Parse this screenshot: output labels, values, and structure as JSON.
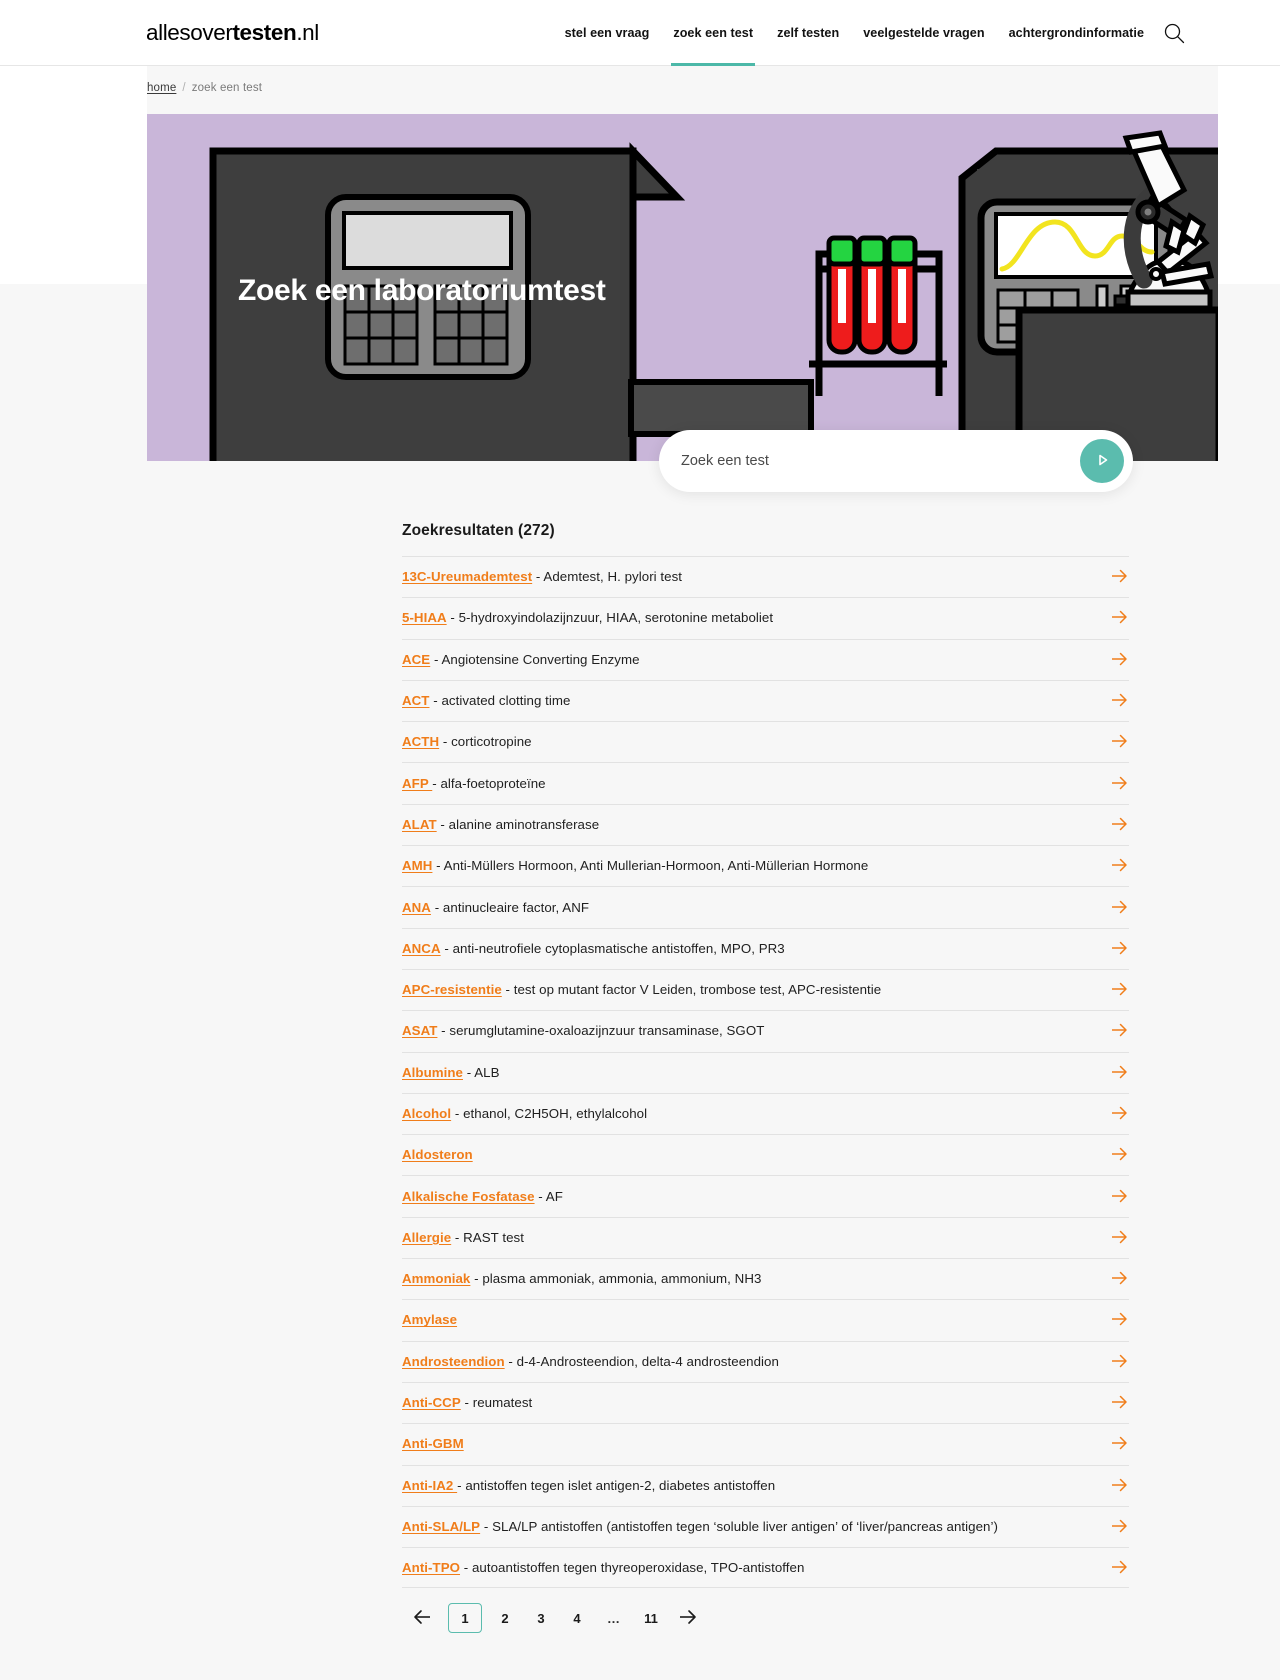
{
  "header": {
    "logo_light_1": "allesover",
    "logo_bold": "testen",
    "logo_light_2": ".nl",
    "nav": [
      {
        "label": "stel een vraag",
        "active": false
      },
      {
        "label": "zoek een test",
        "active": true
      },
      {
        "label": "zelf testen",
        "active": false
      },
      {
        "label": "veelgestelde vragen",
        "active": false
      },
      {
        "label": "achtergrondinformatie",
        "active": false
      }
    ],
    "search_icon": "search-icon"
  },
  "breadcrumb": {
    "home": "home",
    "separator": "/",
    "current": "zoek een test"
  },
  "hero": {
    "title": "Zoek een laboratoriumtest",
    "background_color": "#c9b6d9",
    "illustration": "laboratory-illustration"
  },
  "search": {
    "placeholder": "Zoek een test",
    "value": "",
    "button_icon": "play-arrow-icon",
    "button_color": "#5bbcae"
  },
  "results": {
    "heading": "Zoekresultaten (272)",
    "count": 272,
    "arrow_icon": "arrow-right-icon",
    "link_color": "#f07d1a",
    "items": [
      {
        "term": "13C-Ureumademtest",
        "desc": " - Ademtest, H. pylori test"
      },
      {
        "term": "5-HIAA",
        "desc": " - 5-hydroxyindolazijnzuur, HIAA, serotonine metaboliet"
      },
      {
        "term": "ACE",
        "desc": " - Angiotensine Converting Enzyme"
      },
      {
        "term": "ACT",
        "desc": " - activated clotting time"
      },
      {
        "term": "ACTH",
        "desc": " - corticotropine"
      },
      {
        "term": "AFP ",
        "desc": "- alfa-foetoproteïne"
      },
      {
        "term": "ALAT",
        "desc": " - alanine aminotransferase"
      },
      {
        "term": "AMH",
        "desc": " - Anti-Müllers Hormoon, Anti Mullerian-Hormoon, Anti-Müllerian Hormone"
      },
      {
        "term": "ANA",
        "desc": " - antinucleaire factor, ANF"
      },
      {
        "term": "ANCA",
        "desc": " - anti-neutrofiele cytoplasmatische antistoffen, MPO, PR3"
      },
      {
        "term": "APC-resistentie",
        "desc": " - test op mutant factor V Leiden, trombose test, APC-resistentie"
      },
      {
        "term": "ASAT",
        "desc": " - serumglutamine-oxaloazijnzuur transaminase, SGOT"
      },
      {
        "term": "Albumine",
        "desc": " - ALB"
      },
      {
        "term": "Alcohol",
        "desc": " - ethanol, C2H5OH, ethylalcohol"
      },
      {
        "term": "Aldosteron",
        "desc": ""
      },
      {
        "term": "Alkalische Fosfatase",
        "desc": " - AF"
      },
      {
        "term": "Allergie",
        "desc": " - RAST test"
      },
      {
        "term": "Ammoniak",
        "desc": " - plasma ammoniak, ammonia, ammonium, NH3"
      },
      {
        "term": "Amylase",
        "desc": ""
      },
      {
        "term": "Androsteendion",
        "desc": " - d-4-Androsteendion, delta-4 androsteendion"
      },
      {
        "term": "Anti-CCP",
        "desc": " - reumatest"
      },
      {
        "term": "Anti-GBM",
        "desc": ""
      },
      {
        "term": "Anti-IA2 ",
        "desc": "- antistoffen tegen islet antigen-2, diabetes antistoffen"
      },
      {
        "term": "Anti-SLA/LP",
        "desc": " - SLA/LP antistoffen (antistoffen tegen ‘soluble liver antigen’ of ‘liver/pancreas antigen’)"
      },
      {
        "term": "Anti-TPO",
        "desc": " - autoantistoffen tegen thyreoperoxidase, TPO-antistoffen"
      }
    ]
  },
  "pagination": {
    "prev_icon": "arrow-left-icon",
    "next_icon": "arrow-right-icon",
    "pages": [
      "1",
      "2",
      "3",
      "4",
      "…",
      "11"
    ],
    "current": "1",
    "accent_color": "#5bbcae"
  }
}
